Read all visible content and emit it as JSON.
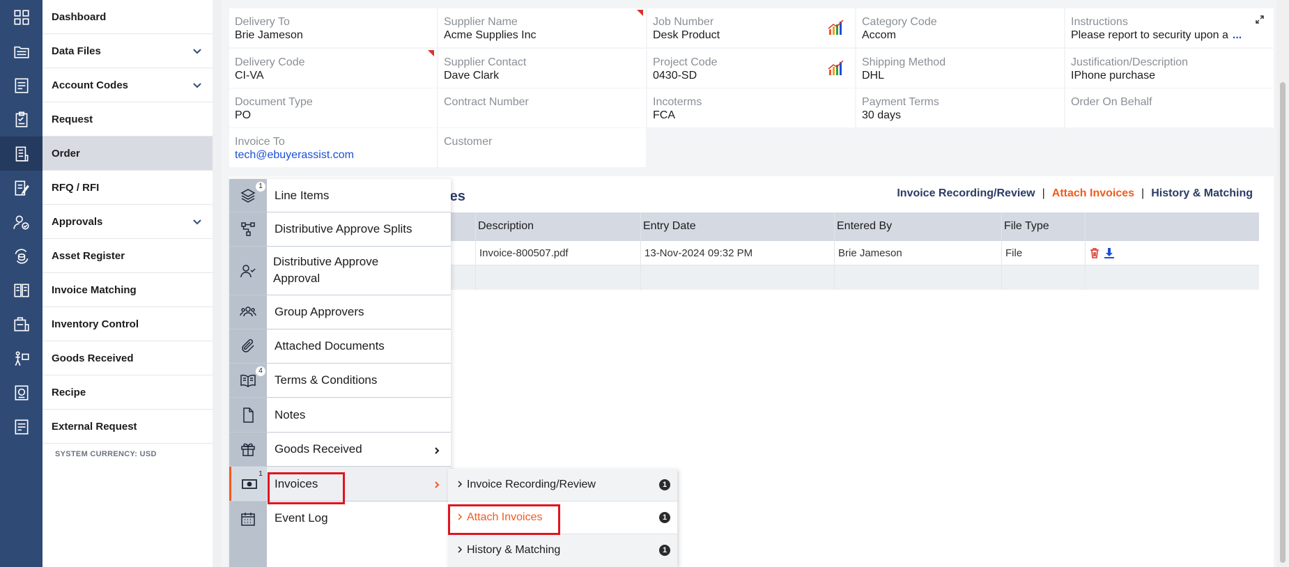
{
  "rail": {
    "icons": [
      "dashboard-icon",
      "data-files-icon",
      "account-codes-icon",
      "request-icon",
      "order-icon",
      "rfq-icon",
      "approvals-icon",
      "asset-register-icon",
      "invoice-matching-icon",
      "inventory-control-icon",
      "goods-received-icon",
      "recipe-icon",
      "external-request-icon"
    ]
  },
  "nav": {
    "items": [
      {
        "label": "Dashboard"
      },
      {
        "label": "Data Files"
      },
      {
        "label": "Account Codes"
      },
      {
        "label": "Request"
      },
      {
        "label": "Order"
      },
      {
        "label": "RFQ / RFI"
      },
      {
        "label": "Approvals"
      },
      {
        "label": "Asset Register"
      },
      {
        "label": "Invoice Matching"
      },
      {
        "label": "Inventory Control"
      },
      {
        "label": "Goods Received"
      },
      {
        "label": "Recipe"
      },
      {
        "label": "External Request"
      }
    ],
    "currency": "SYSTEM CURRENCY: USD"
  },
  "details": {
    "delivery_to": {
      "label": "Delivery To",
      "value": "Brie Jameson"
    },
    "supplier_name": {
      "label": "Supplier Name",
      "value": "Acme Supplies Inc"
    },
    "job_number": {
      "label": "Job Number",
      "value": "Desk Product"
    },
    "category_code": {
      "label": "Category Code",
      "value": "Accom"
    },
    "instructions": {
      "label": "Instructions",
      "value": "Please report to security upon a",
      "more": "..."
    },
    "delivery_code": {
      "label": "Delivery Code",
      "value": "CI-VA"
    },
    "supplier_contact": {
      "label": "Supplier Contact",
      "value": "Dave Clark"
    },
    "project_code": {
      "label": "Project Code",
      "value": "0430-SD"
    },
    "shipping_method": {
      "label": "Shipping Method",
      "value": "DHL"
    },
    "justification": {
      "label": "Justification/Description",
      "value": "IPhone purchase"
    },
    "document_type": {
      "label": "Document Type",
      "value": "PO"
    },
    "contract_number": {
      "label": "Contract Number",
      "value": ""
    },
    "incoterms": {
      "label": "Incoterms",
      "value": "FCA"
    },
    "payment_terms": {
      "label": "Payment Terms",
      "value": "30 days"
    },
    "order_on_behalf": {
      "label": "Order On Behalf",
      "value": ""
    },
    "invoice_to": {
      "label": "Invoice To",
      "value": "tech@ebuyerassist.com"
    },
    "customer": {
      "label": "Customer",
      "value": ""
    }
  },
  "section": {
    "title_partial": "ices",
    "links": {
      "recording": "Invoice Recording/Review",
      "attach": "Attach Invoices",
      "history": "History & Matching",
      "sep": "|"
    },
    "columns": [
      "Description",
      "Entry Date",
      "Entered By",
      "File Type"
    ],
    "rows": [
      {
        "description": "Invoice-800507.pdf",
        "entry_date": "13-Nov-2024 09:32 PM",
        "entered_by": "Brie Jameson",
        "file_type": "File"
      }
    ]
  },
  "menu": {
    "items": [
      {
        "label": "Line Items",
        "badge": "1"
      },
      {
        "label": "Distributive Approve Splits"
      },
      {
        "label": "Distributive Approve Approval"
      },
      {
        "label": "Group Approvers"
      },
      {
        "label": "Attached Documents"
      },
      {
        "label": "Terms & Conditions",
        "badge": "4"
      },
      {
        "label": "Notes"
      },
      {
        "label": "Goods Received"
      },
      {
        "label": "Invoices",
        "badge": "1"
      },
      {
        "label": "Event Log"
      }
    ],
    "submenu": [
      {
        "label": "Invoice Recording/Review",
        "info": "1"
      },
      {
        "label": "Attach Invoices",
        "info": "1"
      },
      {
        "label": "History & Matching",
        "info": "1"
      }
    ]
  }
}
